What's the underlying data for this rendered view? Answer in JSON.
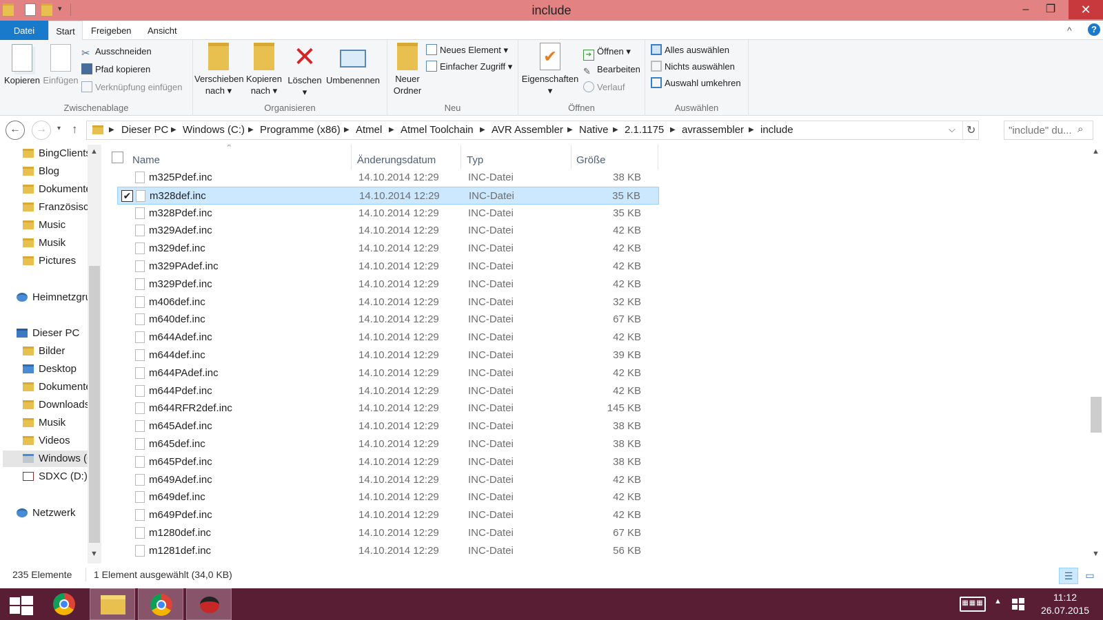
{
  "window": {
    "title": "include",
    "minimize": "–",
    "maximize": "❐",
    "close": "✕"
  },
  "ribbon_tabs": [
    "Datei",
    "Start",
    "Freigeben",
    "Ansicht"
  ],
  "ribbon": {
    "clipboard": {
      "copy": "Kopieren",
      "paste": "Einfügen",
      "cut": "Ausschneiden",
      "copy_path": "Pfad kopieren",
      "paste_shortcut": "Verknüpfung einfügen",
      "label": "Zwischenablage"
    },
    "organize": {
      "move_to_1": "Verschieben",
      "move_to_2": "nach ▾",
      "copy_to_1": "Kopieren",
      "copy_to_2": "nach ▾",
      "delete": "Löschen",
      "delete_arrow": "▾",
      "rename": "Umbenennen",
      "label": "Organisieren"
    },
    "new": {
      "new_folder_1": "Neuer",
      "new_folder_2": "Ordner",
      "new_item": "Neues Element ▾",
      "easy_access": "Einfacher Zugriff ▾",
      "label": "Neu"
    },
    "open": {
      "properties": "Eigenschaften",
      "properties_arrow": "▾",
      "open": "Öffnen ▾",
      "edit": "Bearbeiten",
      "history": "Verlauf",
      "label": "Öffnen"
    },
    "select": {
      "select_all": "Alles auswählen",
      "select_none": "Nichts auswählen",
      "invert": "Auswahl umkehren",
      "label": "Auswählen"
    }
  },
  "address": {
    "crumbs": [
      "Dieser PC",
      "Windows (C:)",
      "Programme (x86)",
      "Atmel",
      "Atmel Toolchain",
      "AVR Assembler",
      "Native",
      "2.1.1175",
      "avrassembler",
      "include"
    ],
    "search_placeholder": "\"include\" du..."
  },
  "sidebar": {
    "items": [
      "BingClients",
      "Blog",
      "Dokumente",
      "Französisch",
      "Music",
      "Musik",
      "Pictures",
      "Heimnetzgruppe",
      "Dieser PC",
      "Bilder",
      "Desktop",
      "Dokumente",
      "Downloads",
      "Musik",
      "Videos",
      "Windows (C:)",
      "SDXC (D:)",
      "Netzwerk"
    ]
  },
  "columns": {
    "name": "Name",
    "date": "Änderungsdatum",
    "type": "Typ",
    "size": "Größe"
  },
  "files": [
    {
      "name": "m325Pdef.inc",
      "date": "14.10.2014 12:29",
      "type": "INC-Datei",
      "size": "38 KB"
    },
    {
      "name": "m328def.inc",
      "date": "14.10.2014 12:29",
      "type": "INC-Datei",
      "size": "35 KB"
    },
    {
      "name": "m328Pdef.inc",
      "date": "14.10.2014 12:29",
      "type": "INC-Datei",
      "size": "35 KB"
    },
    {
      "name": "m329Adef.inc",
      "date": "14.10.2014 12:29",
      "type": "INC-Datei",
      "size": "42 KB"
    },
    {
      "name": "m329def.inc",
      "date": "14.10.2014 12:29",
      "type": "INC-Datei",
      "size": "42 KB"
    },
    {
      "name": "m329PAdef.inc",
      "date": "14.10.2014 12:29",
      "type": "INC-Datei",
      "size": "42 KB"
    },
    {
      "name": "m329Pdef.inc",
      "date": "14.10.2014 12:29",
      "type": "INC-Datei",
      "size": "42 KB"
    },
    {
      "name": "m406def.inc",
      "date": "14.10.2014 12:29",
      "type": "INC-Datei",
      "size": "32 KB"
    },
    {
      "name": "m640def.inc",
      "date": "14.10.2014 12:29",
      "type": "INC-Datei",
      "size": "67 KB"
    },
    {
      "name": "m644Adef.inc",
      "date": "14.10.2014 12:29",
      "type": "INC-Datei",
      "size": "42 KB"
    },
    {
      "name": "m644def.inc",
      "date": "14.10.2014 12:29",
      "type": "INC-Datei",
      "size": "39 KB"
    },
    {
      "name": "m644PAdef.inc",
      "date": "14.10.2014 12:29",
      "type": "INC-Datei",
      "size": "42 KB"
    },
    {
      "name": "m644Pdef.inc",
      "date": "14.10.2014 12:29",
      "type": "INC-Datei",
      "size": "42 KB"
    },
    {
      "name": "m644RFR2def.inc",
      "date": "14.10.2014 12:29",
      "type": "INC-Datei",
      "size": "145 KB"
    },
    {
      "name": "m645Adef.inc",
      "date": "14.10.2014 12:29",
      "type": "INC-Datei",
      "size": "38 KB"
    },
    {
      "name": "m645def.inc",
      "date": "14.10.2014 12:29",
      "type": "INC-Datei",
      "size": "38 KB"
    },
    {
      "name": "m645Pdef.inc",
      "date": "14.10.2014 12:29",
      "type": "INC-Datei",
      "size": "38 KB"
    },
    {
      "name": "m649Adef.inc",
      "date": "14.10.2014 12:29",
      "type": "INC-Datei",
      "size": "42 KB"
    },
    {
      "name": "m649def.inc",
      "date": "14.10.2014 12:29",
      "type": "INC-Datei",
      "size": "42 KB"
    },
    {
      "name": "m649Pdef.inc",
      "date": "14.10.2014 12:29",
      "type": "INC-Datei",
      "size": "42 KB"
    },
    {
      "name": "m1280def.inc",
      "date": "14.10.2014 12:29",
      "type": "INC-Datei",
      "size": "67 KB"
    },
    {
      "name": "m1281def.inc",
      "date": "14.10.2014 12:29",
      "type": "INC-Datei",
      "size": "56 KB"
    }
  ],
  "status": {
    "count": "235 Elemente",
    "selection": "1 Element ausgewählt (34,0 KB)"
  },
  "taskbar": {
    "time": "11:12",
    "date": "26.07.2015"
  },
  "colors": {
    "titlebar": "#e28282",
    "accent": "#1979ca",
    "selection": "#cce8ff",
    "taskbar": "#5a1e34"
  }
}
